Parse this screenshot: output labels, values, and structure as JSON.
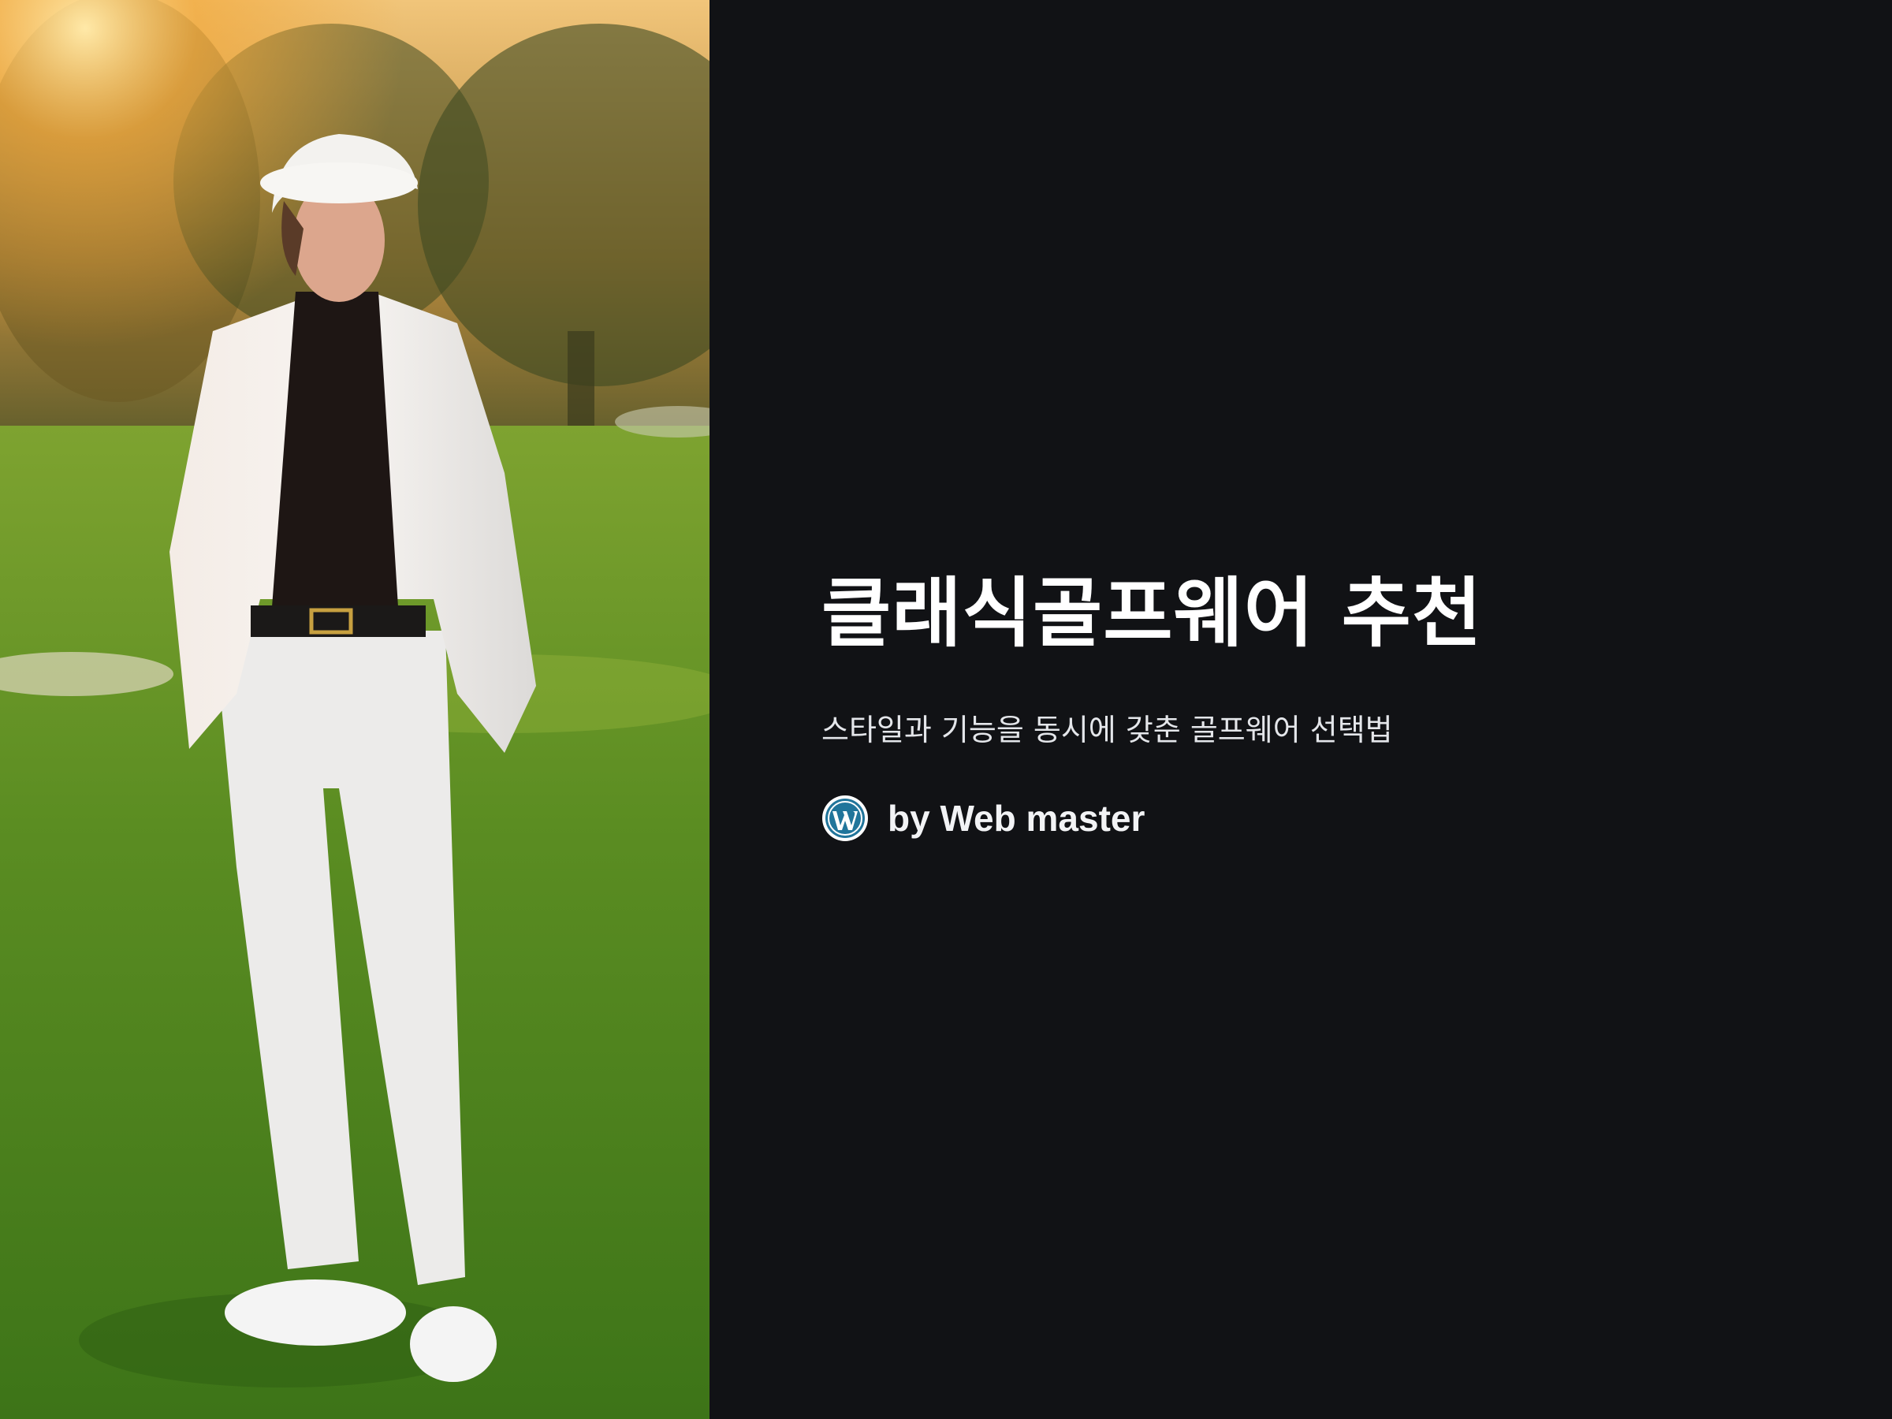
{
  "hero": {
    "title": "클래식골프웨어 추천",
    "subtitle": "스타일과 기능을 동시에 갖춘 골프웨어 선택법",
    "byline": "by Web master",
    "author_icon": "wordpress-icon"
  },
  "image": {
    "subject": "golfer-photo"
  },
  "colors": {
    "background": "#111215",
    "title": "#ffffff",
    "subtitle": "#e4e6ea",
    "wordpress_blue": "#21759b"
  }
}
